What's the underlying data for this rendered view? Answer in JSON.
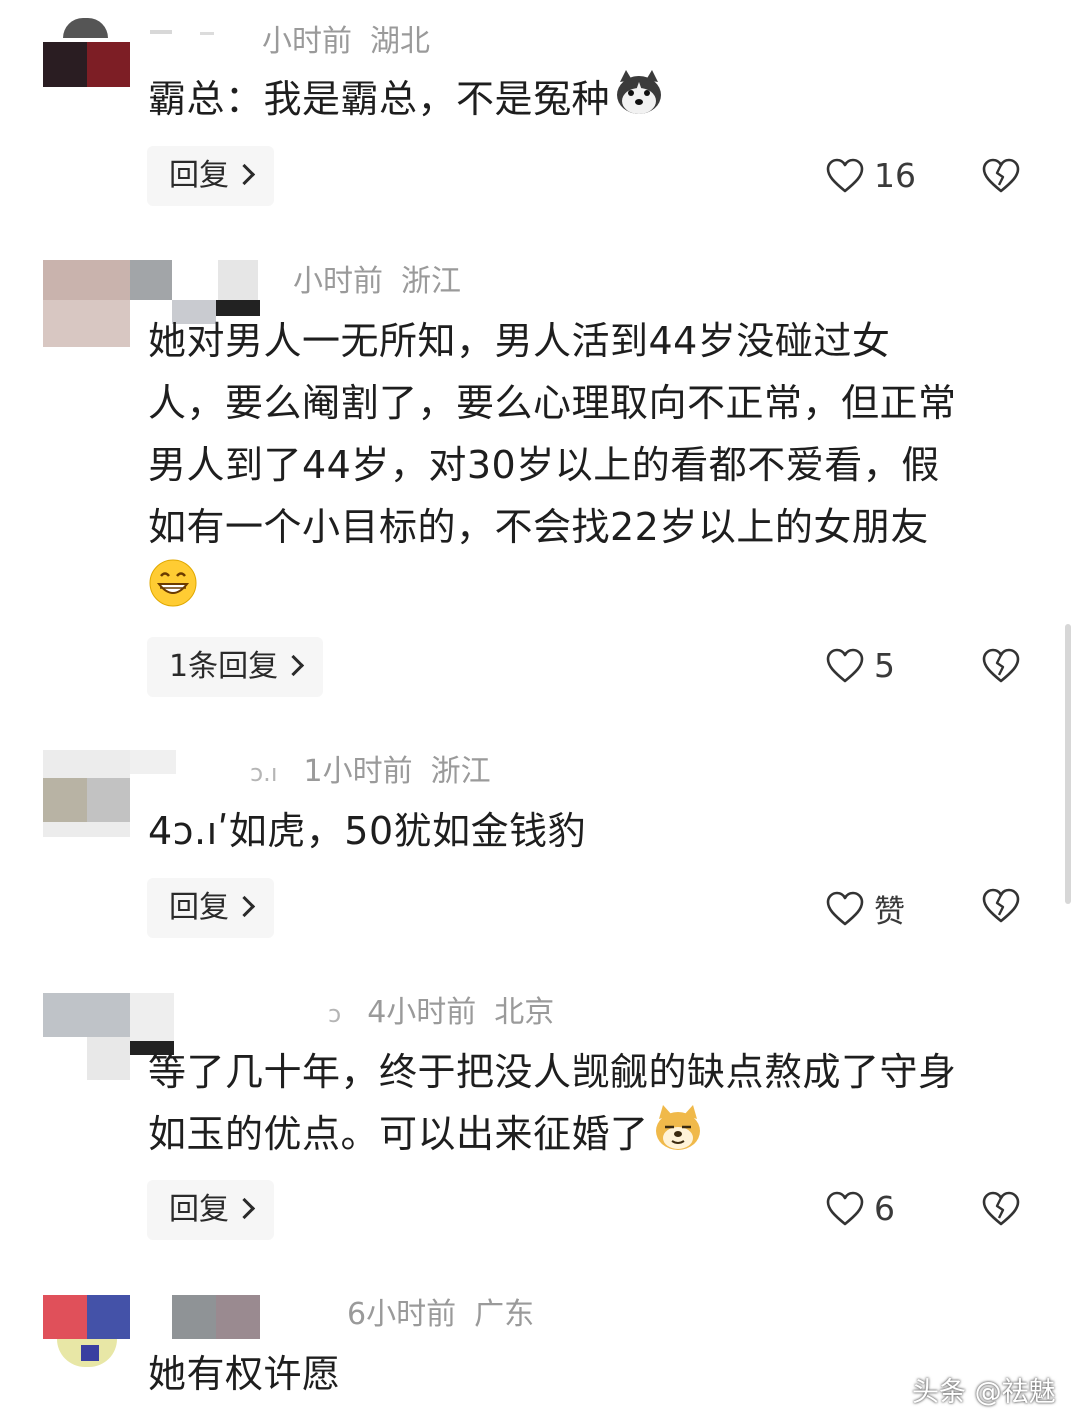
{
  "comments": [
    {
      "time": "小时前",
      "location": "湖北",
      "text_lines": [
        "霸总：我是霸总，不是冤种"
      ],
      "emoji": "husky-emoji",
      "reply_label": "回复",
      "like_count": "16"
    },
    {
      "time": "小时前",
      "location": "浙江",
      "text_lines": [
        "她对男人一无所知，男人活到44岁没碰过女",
        "人，要么阉割了，要么心理取向不正常，但正常",
        "男人到了44岁，对30岁以上的看都不爱看，假",
        "如有一个小目标的，不会找22岁以上的女朋友"
      ],
      "emoji": "grinning-emoji",
      "reply_label": "1条回复",
      "like_count": "5"
    },
    {
      "name_fragment": "ɔ.ı",
      "time": "1小时前",
      "location": "浙江",
      "text_lines": [
        "4ɔ.ıʹ如虎，50犹如金钱豹"
      ],
      "reply_label": "回复",
      "like_count": "赞"
    },
    {
      "name_fragment": "ɔ",
      "time": "4小时前",
      "location": "北京",
      "text_lines": [
        "等了几十年，终于把没人觊觎的缺点熬成了守身",
        "如玉的优点。可以出来征婚了"
      ],
      "emoji": "doge-emoji",
      "reply_label": "回复",
      "like_count": "6"
    },
    {
      "time": "6小时前",
      "location": "广东",
      "text_lines": [
        "她有权许愿"
      ]
    }
  ],
  "watermark": "头条 @祛魅",
  "colors": {
    "meta_gray": "#9a9a9a",
    "text": "#1e1e1e",
    "reply_bg": "#f6f6f6"
  }
}
